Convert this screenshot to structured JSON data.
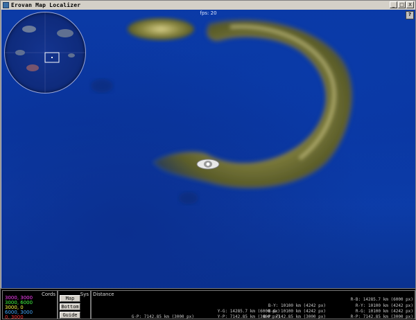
{
  "window": {
    "title": "Erovan Map Localizer",
    "buttons": [
      "_",
      "□",
      "X"
    ]
  },
  "hud": {
    "fps": "fps: 20",
    "help": "?"
  },
  "colors": {
    "ocean": "#0b3aa6",
    "land": "#8d8a43",
    "panel": "#000000"
  },
  "cords": {
    "label": "Cords",
    "items": [
      {
        "text": "3000, 3000",
        "color": "#ff44ff"
      },
      {
        "text": "3000, 6000",
        "color": "#44ff44"
      },
      {
        "text": "3000, 0",
        "color": "#ffff44"
      },
      {
        "text": "6000, 3000",
        "color": "#44aaff"
      },
      {
        "text": "0, 3000",
        "color": "#ff3333"
      }
    ]
  },
  "sys": {
    "label": "Sys",
    "buttons": [
      "Map",
      "Bottom",
      "Guide"
    ]
  },
  "distance": {
    "label": "Distance",
    "columns": [
      {
        "rows": [
          "G-P: 7142.85 km (3000 px)"
        ]
      },
      {
        "rows": [
          "Y-G: 14285.7 km (6000 px)",
          "Y-P: 7142.85 km (3000 px)"
        ]
      },
      {
        "rows": [
          "B-Y: 10100 km (4242 px)",
          "B-G: 10100 km (4242 px)",
          "B-P: 7142.85 km (3000 px)"
        ]
      },
      {
        "rows": [
          "R-B: 14285.7 km (6000 px)",
          "R-Y: 10100 km (4242 px)",
          "R-G: 10100 km (4242 px)",
          "R-P: 7142.85 km (3000 px)"
        ]
      }
    ]
  }
}
